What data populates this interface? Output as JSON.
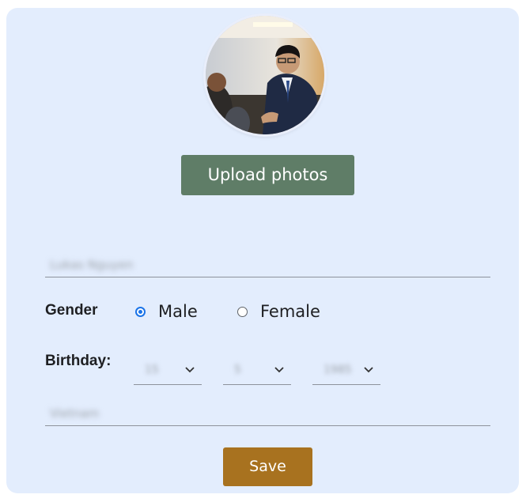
{
  "profile": {
    "upload_label": "Upload photos",
    "name_value": "Lukas Nguyen"
  },
  "gender": {
    "label": "Gender",
    "options": [
      "Male",
      "Female"
    ],
    "selected": "Male"
  },
  "birthday": {
    "label": "Birthday:",
    "day": "15",
    "month": "5",
    "year": "1985"
  },
  "country": {
    "value": "Vietnam"
  },
  "actions": {
    "save_label": "Save"
  },
  "colors": {
    "card_bg": "#e3edfd",
    "upload_button": "#5f7d67",
    "save_button": "#a8721f",
    "radio_accent": "#1a73e8"
  },
  "icons": {
    "dropdown": "chevron-down-icon",
    "radio_checked": "radio-checked-icon",
    "radio_unchecked": "radio-unchecked-icon"
  }
}
